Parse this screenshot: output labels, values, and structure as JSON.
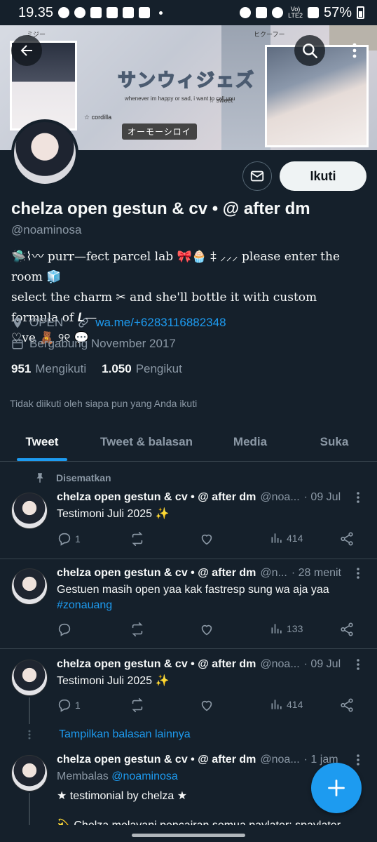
{
  "status_bar": {
    "time": "19.35",
    "network": "Vo)\nLTE2",
    "battery": "57%"
  },
  "banner": {
    "title": "サンウィジェズ",
    "subtitle": "whenever im happy or sad, i want to call you",
    "tag": "オーモーシロイ",
    "sparkle": "☆ cordilla",
    "doodle1": "ミジー",
    "doodle2": "ヒクーフー",
    "doodle3": "☆ sweet"
  },
  "profile": {
    "name": "chelza open gestun & cv • @ after dm",
    "handle": "@noaminosa",
    "bio_line1": "🛸⌇〰 purr—fect parcel lab 🎀🧁 ‡ ⸝⸝⸝ please enter the room 🧊",
    "bio_line2": "select the charm  ✂  and she'll bottle it with custom formula of 𝑳—",
    "bio_line3": "♡ve  🧸  ୨୧  💬",
    "location": "OPEN",
    "website": "wa.me/+6283116882348",
    "joined": "Bergabung November 2017",
    "following_count": "951",
    "following_label": "Mengikuti",
    "followers_count": "1.050",
    "followers_label": "Pengikut",
    "not_followed": "Tidak diikuti oleh siapa pun yang Anda ikuti",
    "follow_label": "Ikuti"
  },
  "tabs": [
    "Tweet",
    "Tweet & balasan",
    "Media",
    "Suka"
  ],
  "pinned_label": "Disematkan",
  "tweets": [
    {
      "name": "chelza open gestun & cv • @ after dm",
      "handle": "@noa...",
      "time": "· 09 Jul",
      "text": "Testimoni Juli 2025 ✨",
      "replies": "1",
      "retweets": "",
      "likes": "",
      "views": "414"
    },
    {
      "name": "chelza open gestun & cv • @ after dm",
      "handle": "@n...",
      "time": "· 28 menit",
      "text": "Gestuen masih open yaa kak fastresp sung wa aja yaa",
      "hashtag": "#zonauang",
      "replies": "",
      "retweets": "",
      "likes": "",
      "views": "133"
    },
    {
      "name": "chelza open gestun & cv • @ after dm",
      "handle": "@noa...",
      "time": "· 09 Jul",
      "text": "Testimoni Juli 2025 ✨",
      "replies": "1",
      "retweets": "",
      "likes": "",
      "views": "414"
    },
    {
      "name": "chelza open gestun & cv • @ after dm",
      "handle": "@noa...",
      "time": "· 1 jam",
      "reply_prefix": "Membalas",
      "reply_handle": "@noaminosa",
      "text": "★ testimonial by chelza ★",
      "text2": "💫 Chelza melayani pencairan semua paylater: spaylater"
    }
  ],
  "show_more_replies": "Tampilkan balasan lainnya",
  "colors": {
    "background": "#15202b",
    "accent": "#1d9bf0",
    "secondary_text": "#8b98a5",
    "divider": "#38444d"
  }
}
